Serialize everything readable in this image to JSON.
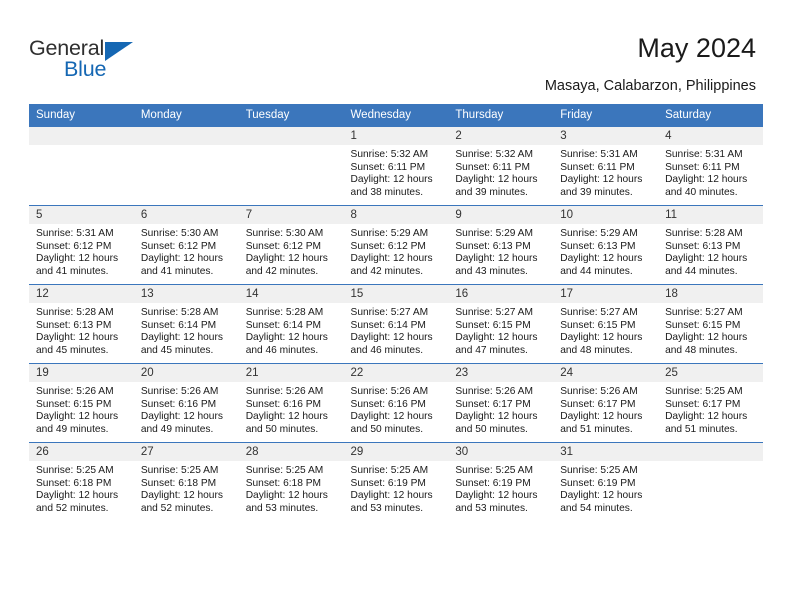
{
  "logo": {
    "word_top": "General",
    "word_bottom": "Blue",
    "triangle_icon": "blue-triangle-icon",
    "color_text": "#2f2f2f",
    "color_blue": "#1567b3"
  },
  "header": {
    "title": "May 2024",
    "subtitle": "Masaya, Calabarzon, Philippines"
  },
  "theme": {
    "header_blue": "#3b76bc",
    "daynum_bg": "#f0f0f0",
    "text": "#1a1a1a"
  },
  "calendar": {
    "weekday_headers": [
      "Sunday",
      "Monday",
      "Tuesday",
      "Wednesday",
      "Thursday",
      "Friday",
      "Saturday"
    ],
    "labels": {
      "sunrise": "Sunrise:",
      "sunset": "Sunset:",
      "daylight": "Daylight:"
    },
    "weeks": [
      [
        {
          "day": "",
          "empty": true
        },
        {
          "day": "",
          "empty": true
        },
        {
          "day": "",
          "empty": true
        },
        {
          "day": "1",
          "sunrise": "Sunrise: 5:32 AM",
          "sunset": "Sunset: 6:11 PM",
          "daylight": "Daylight: 12 hours and 38 minutes."
        },
        {
          "day": "2",
          "sunrise": "Sunrise: 5:32 AM",
          "sunset": "Sunset: 6:11 PM",
          "daylight": "Daylight: 12 hours and 39 minutes."
        },
        {
          "day": "3",
          "sunrise": "Sunrise: 5:31 AM",
          "sunset": "Sunset: 6:11 PM",
          "daylight": "Daylight: 12 hours and 39 minutes."
        },
        {
          "day": "4",
          "sunrise": "Sunrise: 5:31 AM",
          "sunset": "Sunset: 6:11 PM",
          "daylight": "Daylight: 12 hours and 40 minutes."
        }
      ],
      [
        {
          "day": "5",
          "sunrise": "Sunrise: 5:31 AM",
          "sunset": "Sunset: 6:12 PM",
          "daylight": "Daylight: 12 hours and 41 minutes."
        },
        {
          "day": "6",
          "sunrise": "Sunrise: 5:30 AM",
          "sunset": "Sunset: 6:12 PM",
          "daylight": "Daylight: 12 hours and 41 minutes."
        },
        {
          "day": "7",
          "sunrise": "Sunrise: 5:30 AM",
          "sunset": "Sunset: 6:12 PM",
          "daylight": "Daylight: 12 hours and 42 minutes."
        },
        {
          "day": "8",
          "sunrise": "Sunrise: 5:29 AM",
          "sunset": "Sunset: 6:12 PM",
          "daylight": "Daylight: 12 hours and 42 minutes."
        },
        {
          "day": "9",
          "sunrise": "Sunrise: 5:29 AM",
          "sunset": "Sunset: 6:13 PM",
          "daylight": "Daylight: 12 hours and 43 minutes."
        },
        {
          "day": "10",
          "sunrise": "Sunrise: 5:29 AM",
          "sunset": "Sunset: 6:13 PM",
          "daylight": "Daylight: 12 hours and 44 minutes."
        },
        {
          "day": "11",
          "sunrise": "Sunrise: 5:28 AM",
          "sunset": "Sunset: 6:13 PM",
          "daylight": "Daylight: 12 hours and 44 minutes."
        }
      ],
      [
        {
          "day": "12",
          "sunrise": "Sunrise: 5:28 AM",
          "sunset": "Sunset: 6:13 PM",
          "daylight": "Daylight: 12 hours and 45 minutes."
        },
        {
          "day": "13",
          "sunrise": "Sunrise: 5:28 AM",
          "sunset": "Sunset: 6:14 PM",
          "daylight": "Daylight: 12 hours and 45 minutes."
        },
        {
          "day": "14",
          "sunrise": "Sunrise: 5:28 AM",
          "sunset": "Sunset: 6:14 PM",
          "daylight": "Daylight: 12 hours and 46 minutes."
        },
        {
          "day": "15",
          "sunrise": "Sunrise: 5:27 AM",
          "sunset": "Sunset: 6:14 PM",
          "daylight": "Daylight: 12 hours and 46 minutes."
        },
        {
          "day": "16",
          "sunrise": "Sunrise: 5:27 AM",
          "sunset": "Sunset: 6:15 PM",
          "daylight": "Daylight: 12 hours and 47 minutes."
        },
        {
          "day": "17",
          "sunrise": "Sunrise: 5:27 AM",
          "sunset": "Sunset: 6:15 PM",
          "daylight": "Daylight: 12 hours and 48 minutes."
        },
        {
          "day": "18",
          "sunrise": "Sunrise: 5:27 AM",
          "sunset": "Sunset: 6:15 PM",
          "daylight": "Daylight: 12 hours and 48 minutes."
        }
      ],
      [
        {
          "day": "19",
          "sunrise": "Sunrise: 5:26 AM",
          "sunset": "Sunset: 6:15 PM",
          "daylight": "Daylight: 12 hours and 49 minutes."
        },
        {
          "day": "20",
          "sunrise": "Sunrise: 5:26 AM",
          "sunset": "Sunset: 6:16 PM",
          "daylight": "Daylight: 12 hours and 49 minutes."
        },
        {
          "day": "21",
          "sunrise": "Sunrise: 5:26 AM",
          "sunset": "Sunset: 6:16 PM",
          "daylight": "Daylight: 12 hours and 50 minutes."
        },
        {
          "day": "22",
          "sunrise": "Sunrise: 5:26 AM",
          "sunset": "Sunset: 6:16 PM",
          "daylight": "Daylight: 12 hours and 50 minutes."
        },
        {
          "day": "23",
          "sunrise": "Sunrise: 5:26 AM",
          "sunset": "Sunset: 6:17 PM",
          "daylight": "Daylight: 12 hours and 50 minutes."
        },
        {
          "day": "24",
          "sunrise": "Sunrise: 5:26 AM",
          "sunset": "Sunset: 6:17 PM",
          "daylight": "Daylight: 12 hours and 51 minutes."
        },
        {
          "day": "25",
          "sunrise": "Sunrise: 5:25 AM",
          "sunset": "Sunset: 6:17 PM",
          "daylight": "Daylight: 12 hours and 51 minutes."
        }
      ],
      [
        {
          "day": "26",
          "sunrise": "Sunrise: 5:25 AM",
          "sunset": "Sunset: 6:18 PM",
          "daylight": "Daylight: 12 hours and 52 minutes."
        },
        {
          "day": "27",
          "sunrise": "Sunrise: 5:25 AM",
          "sunset": "Sunset: 6:18 PM",
          "daylight": "Daylight: 12 hours and 52 minutes."
        },
        {
          "day": "28",
          "sunrise": "Sunrise: 5:25 AM",
          "sunset": "Sunset: 6:18 PM",
          "daylight": "Daylight: 12 hours and 53 minutes."
        },
        {
          "day": "29",
          "sunrise": "Sunrise: 5:25 AM",
          "sunset": "Sunset: 6:19 PM",
          "daylight": "Daylight: 12 hours and 53 minutes."
        },
        {
          "day": "30",
          "sunrise": "Sunrise: 5:25 AM",
          "sunset": "Sunset: 6:19 PM",
          "daylight": "Daylight: 12 hours and 53 minutes."
        },
        {
          "day": "31",
          "sunrise": "Sunrise: 5:25 AM",
          "sunset": "Sunset: 6:19 PM",
          "daylight": "Daylight: 12 hours and 54 minutes."
        },
        {
          "day": "",
          "empty": true
        }
      ]
    ]
  }
}
